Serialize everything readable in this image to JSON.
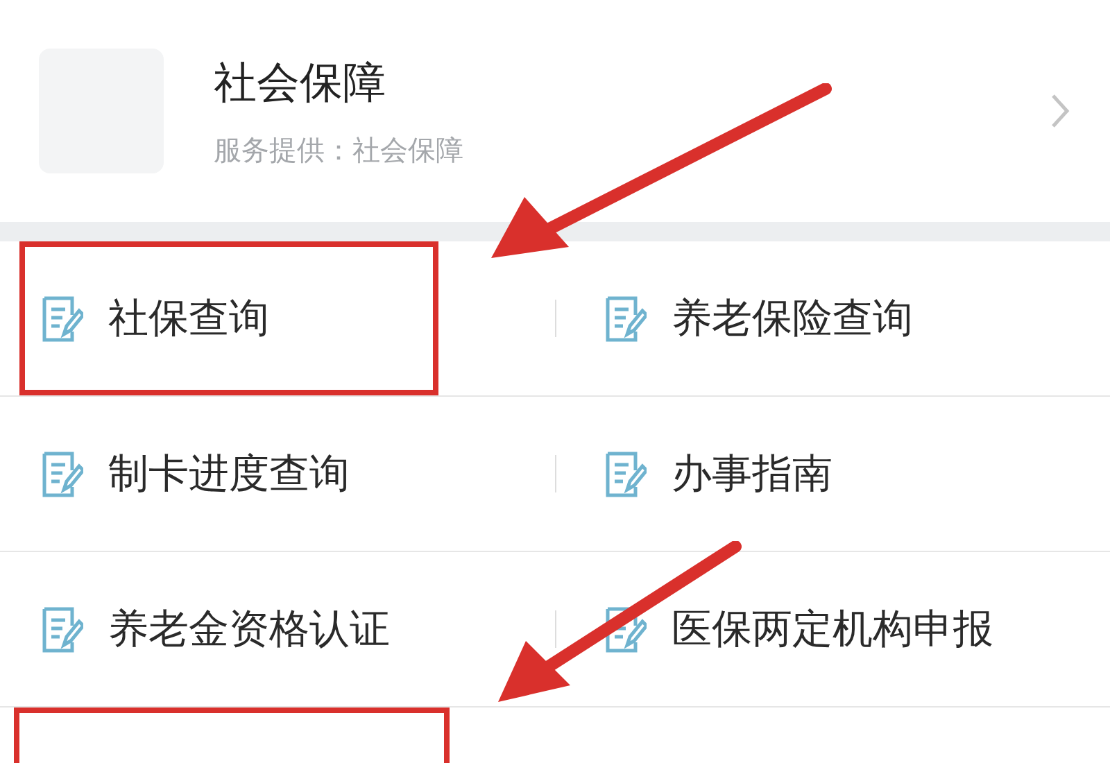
{
  "service": {
    "title": "社会保障",
    "provider": "服务提供：社会保障"
  },
  "rows": [
    [
      {
        "label": "社保查询",
        "highlighted": true
      },
      {
        "label": "养老保险查询",
        "highlighted": false
      }
    ],
    [
      {
        "label": "制卡进度查询",
        "highlighted": false
      },
      {
        "label": "办事指南",
        "highlighted": false
      }
    ],
    [
      {
        "label": "养老金资格认证",
        "highlighted": false
      },
      {
        "label": "医保两定机构申报",
        "highlighted": false
      }
    ]
  ],
  "partial_row": {
    "highlighted": true
  }
}
